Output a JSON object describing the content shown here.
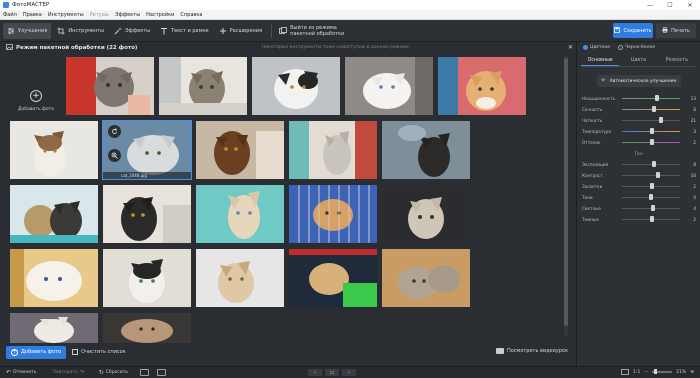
{
  "window": {
    "title": "ФотоМАСТЕР",
    "controls": [
      "—",
      "☐",
      "✕"
    ]
  },
  "menu": [
    {
      "label": "Файл",
      "disabled": false
    },
    {
      "label": "Правка",
      "disabled": false
    },
    {
      "label": "Инструменты",
      "disabled": false
    },
    {
      "label": "Ретушь",
      "disabled": true
    },
    {
      "label": "Эффекты",
      "disabled": false
    },
    {
      "label": "Настройки",
      "disabled": false
    },
    {
      "label": "Справка",
      "disabled": false
    }
  ],
  "toolbar": {
    "tabs": [
      {
        "label": "Улучшения",
        "icon": "sliders-icon",
        "active": true
      },
      {
        "label": "Инструменты",
        "icon": "crop-icon",
        "active": false
      },
      {
        "label": "Эффекты",
        "icon": "magic-icon",
        "active": false
      },
      {
        "label": "Текст и рамки",
        "icon": "text-icon",
        "active": false
      },
      {
        "label": "Расширения",
        "icon": "plus-icon",
        "active": false
      }
    ],
    "exit_batch_line1": "Выйти из режима",
    "exit_batch_line2": "пакетной обработки",
    "save_label": "Сохранить",
    "print_label": "Печать"
  },
  "gallery": {
    "title": "Режим пакетной обработки (22 фото)",
    "hint": "Некоторые инструменты тоже недоступны в данном режиме",
    "add_photo_label": "Добавить фото",
    "selected_filename": "cat_2048.jpg",
    "add_button": "Добавить фото",
    "clear_button": "Очистить список",
    "video_button": "Посмотреть видеоурок"
  },
  "panel": {
    "mode_options": [
      {
        "label": "Цветное",
        "selected": true
      },
      {
        "label": "Черно-белое",
        "selected": false
      }
    ],
    "tabs": [
      {
        "label": "Основные",
        "active": true
      },
      {
        "label": "Цвета",
        "active": false
      },
      {
        "label": "Резкость",
        "active": false
      }
    ],
    "auto_button": "Автоматическое улучшение",
    "sliders_top": [
      {
        "label": "Насыщенность",
        "value": "13",
        "level": 0.6
      },
      {
        "label": "Сочность",
        "value": "6",
        "level": 0.55
      },
      {
        "label": "Четкость",
        "value": "21",
        "level": 0.68
      },
      {
        "label": "Температура",
        "value": "3",
        "level": 0.52
      },
      {
        "label": "Оттенок",
        "value": "2",
        "level": 0.51
      }
    ],
    "tone_label": "Тон",
    "sliders_tone": [
      {
        "label": "Экспозиция",
        "value": "8",
        "level": 0.56
      },
      {
        "label": "Контраст",
        "value": "16",
        "level": 0.62
      },
      {
        "label": "Засветки",
        "value": "2",
        "level": 0.51
      },
      {
        "label": "Тени",
        "value": "0",
        "level": 0.5
      },
      {
        "label": "Светлые",
        "value": "4",
        "level": 0.53
      },
      {
        "label": "Темные",
        "value": "2",
        "level": 0.51
      }
    ]
  },
  "statusbar": {
    "undo": "Отменить",
    "redo": "Повторить",
    "reset": "Сбросить",
    "ratio": "1:1",
    "zoom": "21%"
  }
}
